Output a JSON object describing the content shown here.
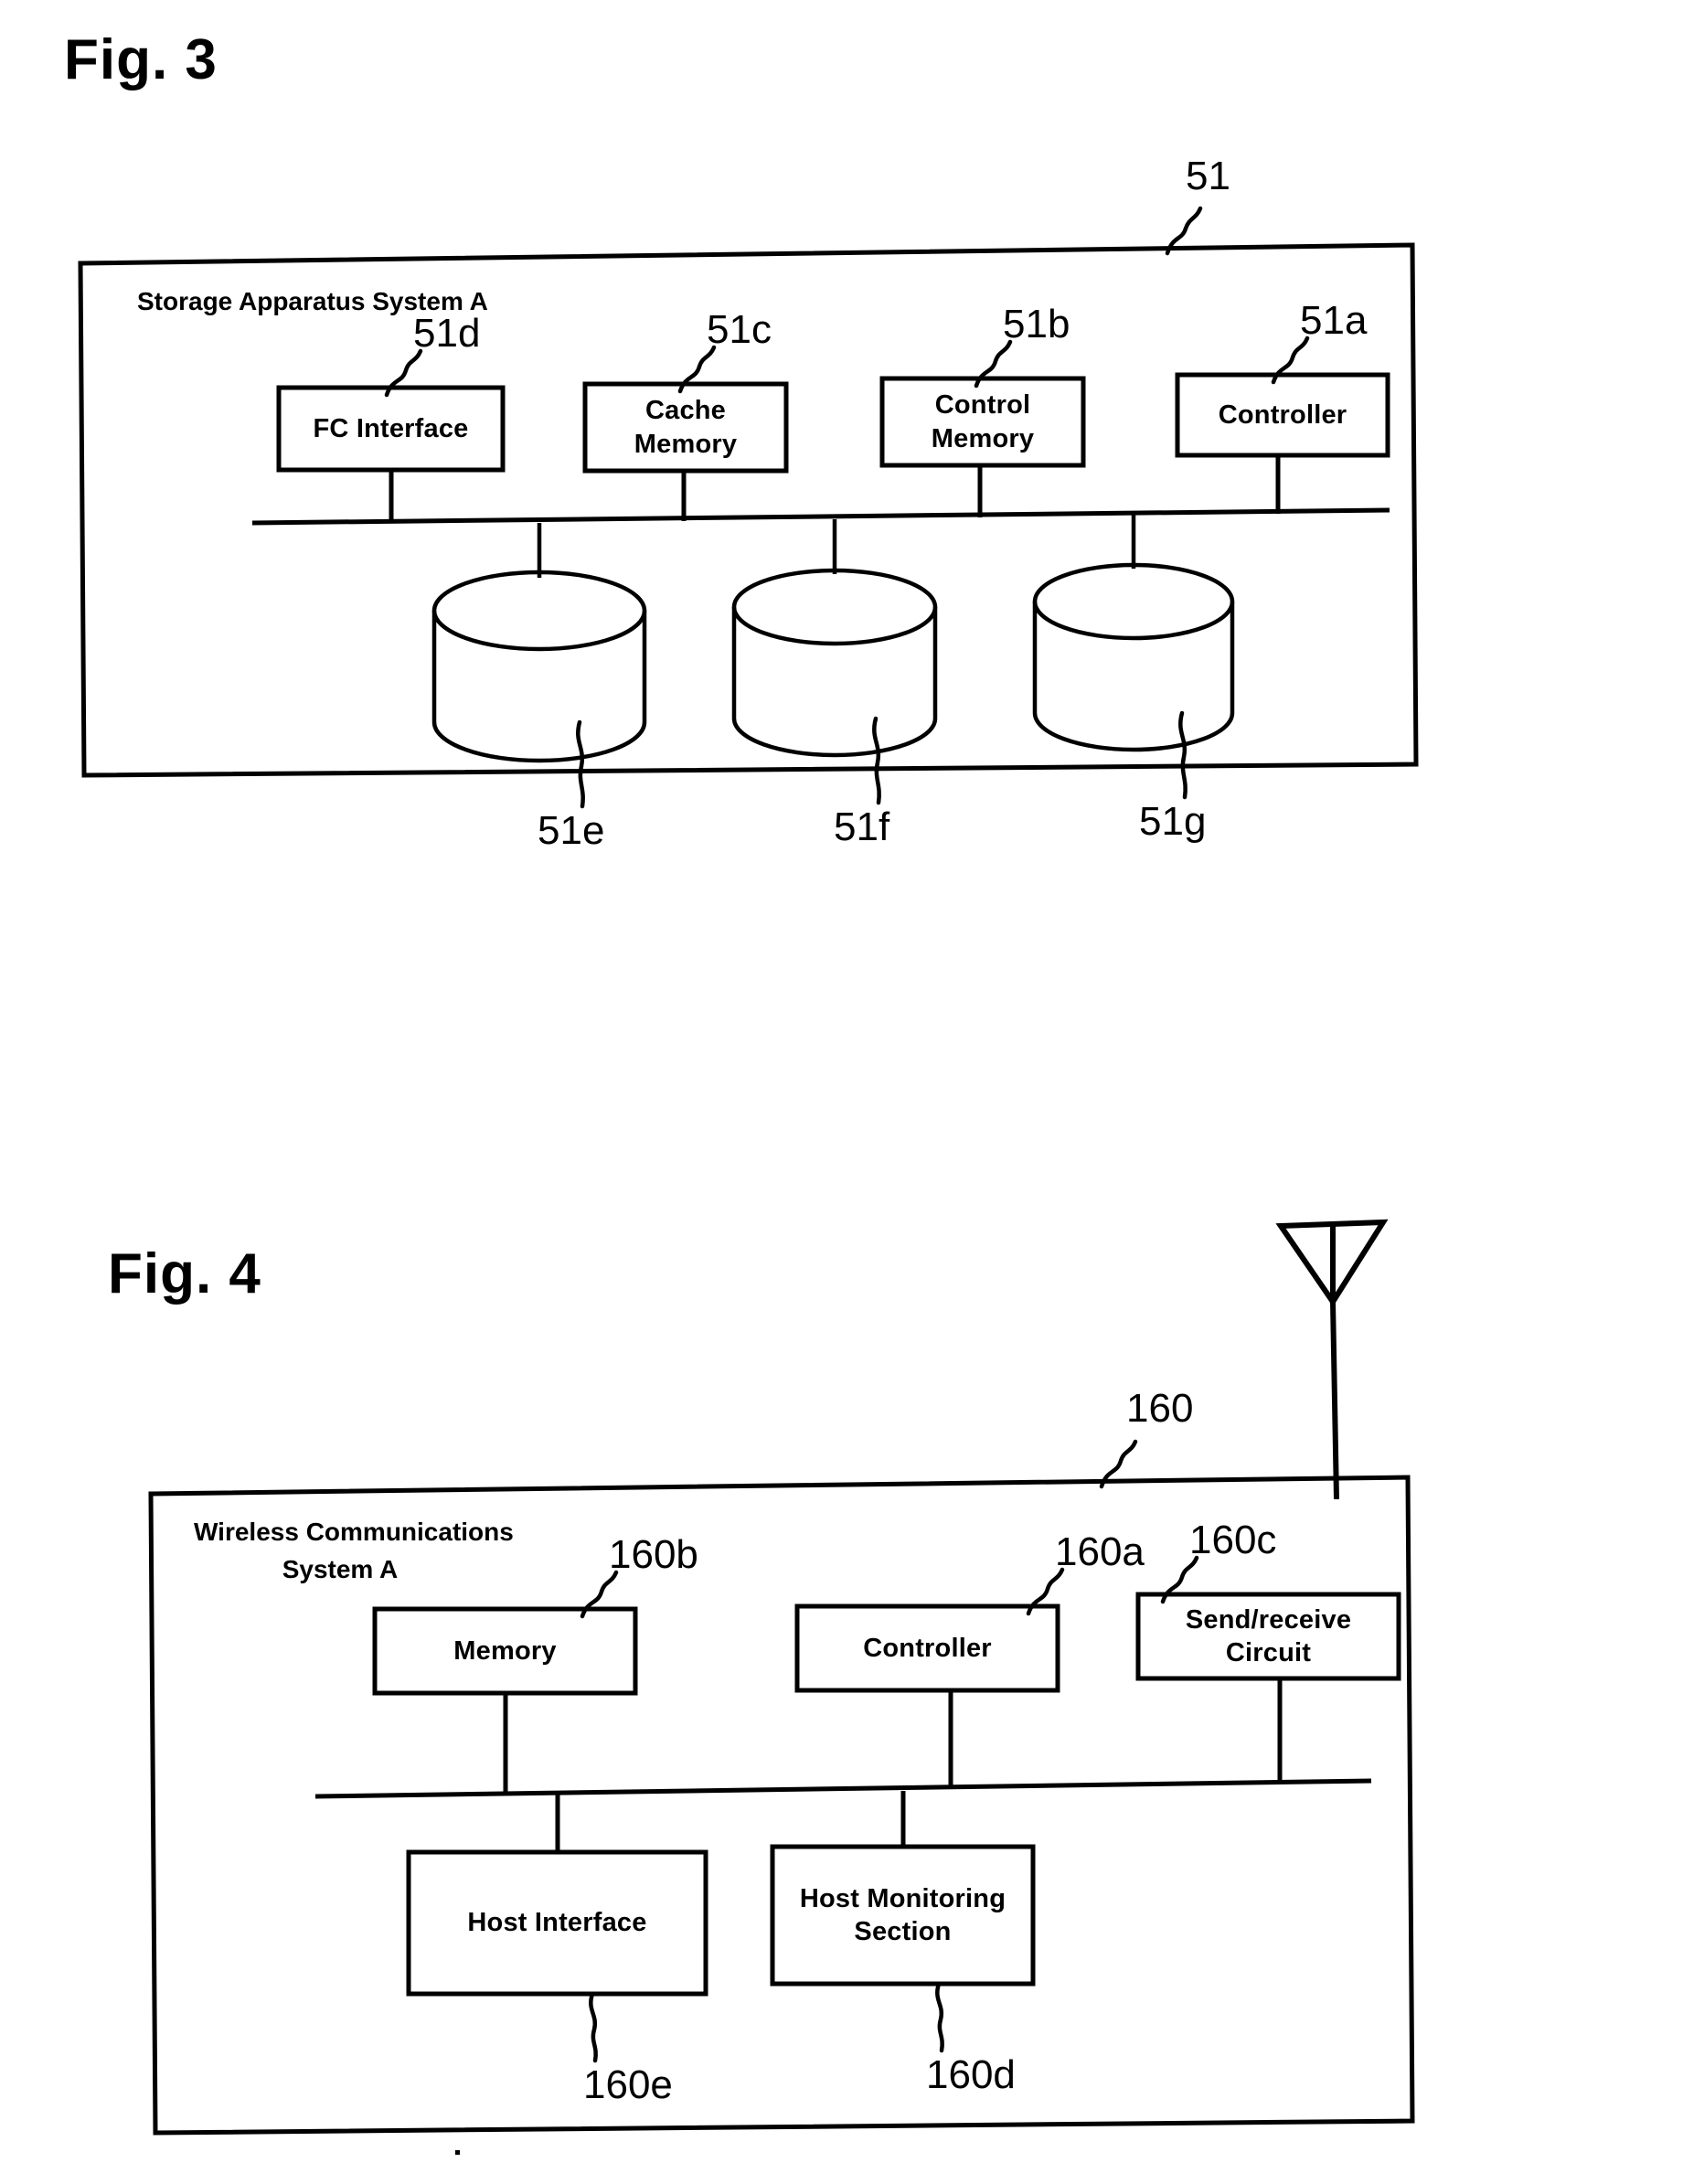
{
  "figures": [
    {
      "title": "Fig. 3",
      "system_label": "Storage Apparatus System  A",
      "outer_ref": "51",
      "top_boxes": [
        {
          "label": "FC Interface",
          "ref": "51d"
        },
        {
          "label": "Cache\nMemory",
          "ref": "51c"
        },
        {
          "label": "Control\nMemory",
          "ref": "51b"
        },
        {
          "label": "Controller",
          "ref": "51a"
        }
      ],
      "disks": [
        {
          "ref": "51e"
        },
        {
          "ref": "51f"
        },
        {
          "ref": "51g"
        }
      ]
    },
    {
      "title": "Fig. 4",
      "system_label_line1": "Wireless Communications",
      "system_label_line2": "System  A",
      "outer_ref": "160",
      "top_boxes": [
        {
          "label": "Memory",
          "ref": "160b"
        },
        {
          "label": "Controller",
          "ref": "160a"
        },
        {
          "label": "Send/receive\nCircuit",
          "ref": "160c"
        }
      ],
      "bottom_boxes": [
        {
          "label": "Host Interface",
          "ref": "160e"
        },
        {
          "label": "Host Monitoring\nSection",
          "ref": "160d"
        }
      ],
      "antenna": "antenna-icon"
    }
  ],
  "fig3": {
    "title": "Fig. 3",
    "system_label": "Storage Apparatus System  A",
    "outer_ref": "51",
    "box_fc": "FC Interface",
    "box_fc_ref": "51d",
    "box_cache_l1": "Cache",
    "box_cache_l2": "Memory",
    "box_cache_ref": "51c",
    "box_ctrlmem_l1": "Control",
    "box_ctrlmem_l2": "Memory",
    "box_ctrlmem_ref": "51b",
    "box_controller": "Controller",
    "box_controller_ref": "51a",
    "disk1_ref": "51e",
    "disk2_ref": "51f",
    "disk3_ref": "51g"
  },
  "fig4": {
    "title": "Fig. 4",
    "system_label_l1": "Wireless Communications",
    "system_label_l2": "System  A",
    "outer_ref": "160",
    "box_memory": "Memory",
    "box_memory_ref": "160b",
    "box_controller": "Controller",
    "box_controller_ref": "160a",
    "box_sendrecv_l1": "Send/receive",
    "box_sendrecv_l2": "Circuit",
    "box_sendrecv_ref": "160c",
    "box_hostif": "Host Interface",
    "box_hostif_ref": "160e",
    "box_hostmon_l1": "Host Monitoring",
    "box_hostmon_l2": "Section",
    "box_hostmon_ref": "160d"
  },
  "colors": {
    "ink": "#000000",
    "paper": "#ffffff"
  }
}
